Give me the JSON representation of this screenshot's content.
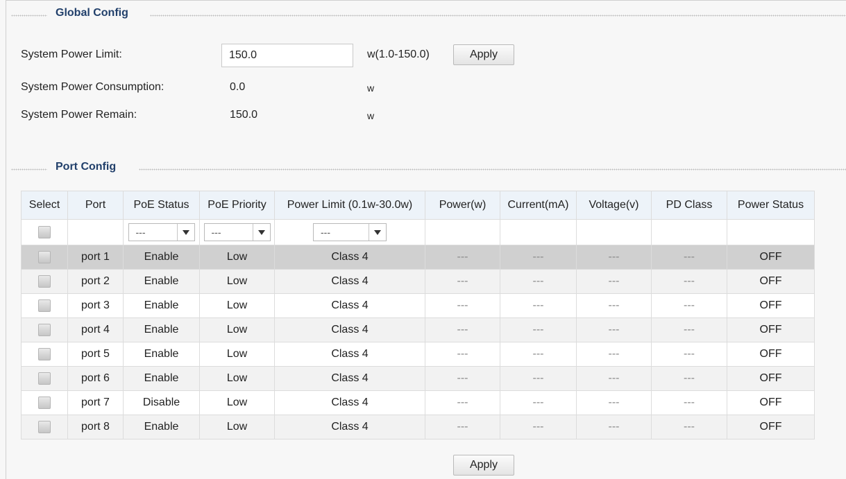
{
  "global_config": {
    "title": "Global Config",
    "power_limit_label": "System Power Limit:",
    "power_limit_value": "150.0",
    "power_limit_range": "w(1.0-150.0)",
    "apply_label": "Apply",
    "consumption_label": "System Power Consumption:",
    "consumption_value": "0.0",
    "consumption_unit": "w",
    "remain_label": "System Power Remain:",
    "remain_value": "150.0",
    "remain_unit": "w"
  },
  "port_config": {
    "title": "Port Config",
    "columns": [
      "Select",
      "Port",
      "PoE Status",
      "PoE Priority",
      "Power Limit (0.1w-30.0w)",
      "Power(w)",
      "Current(mA)",
      "Voltage(v)",
      "PD Class",
      "Power Status"
    ],
    "filter": {
      "poe_status": "---",
      "poe_priority": "---",
      "power_limit": "---"
    },
    "rows": [
      {
        "port": "port 1",
        "poe_status": "Enable",
        "priority": "Low",
        "power_limit": "Class 4",
        "power": "---",
        "current": "---",
        "voltage": "---",
        "pd_class": "---",
        "power_status": "OFF",
        "selected": true
      },
      {
        "port": "port 2",
        "poe_status": "Enable",
        "priority": "Low",
        "power_limit": "Class 4",
        "power": "---",
        "current": "---",
        "voltage": "---",
        "pd_class": "---",
        "power_status": "OFF"
      },
      {
        "port": "port 3",
        "poe_status": "Enable",
        "priority": "Low",
        "power_limit": "Class 4",
        "power": "---",
        "current": "---",
        "voltage": "---",
        "pd_class": "---",
        "power_status": "OFF"
      },
      {
        "port": "port 4",
        "poe_status": "Enable",
        "priority": "Low",
        "power_limit": "Class 4",
        "power": "---",
        "current": "---",
        "voltage": "---",
        "pd_class": "---",
        "power_status": "OFF"
      },
      {
        "port": "port 5",
        "poe_status": "Enable",
        "priority": "Low",
        "power_limit": "Class 4",
        "power": "---",
        "current": "---",
        "voltage": "---",
        "pd_class": "---",
        "power_status": "OFF"
      },
      {
        "port": "port 6",
        "poe_status": "Enable",
        "priority": "Low",
        "power_limit": "Class 4",
        "power": "---",
        "current": "---",
        "voltage": "---",
        "pd_class": "---",
        "power_status": "OFF"
      },
      {
        "port": "port 7",
        "poe_status": "Disable",
        "priority": "Low",
        "power_limit": "Class 4",
        "power": "---",
        "current": "---",
        "voltage": "---",
        "pd_class": "---",
        "power_status": "OFF"
      },
      {
        "port": "port 8",
        "poe_status": "Enable",
        "priority": "Low",
        "power_limit": "Class 4",
        "power": "---",
        "current": "---",
        "voltage": "---",
        "pd_class": "---",
        "power_status": "OFF"
      }
    ],
    "apply_label": "Apply"
  }
}
